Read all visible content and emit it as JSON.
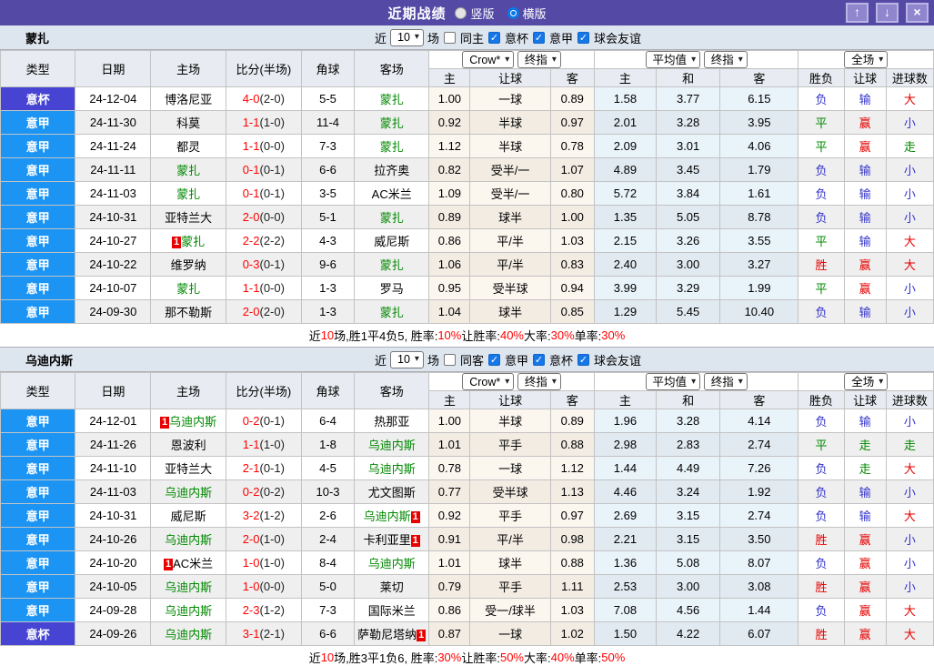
{
  "titlebar": {
    "title": "近期战绩",
    "radios": [
      {
        "label": "竖版",
        "selected": false
      },
      {
        "label": "横版",
        "selected": true
      }
    ],
    "window_buttons": [
      {
        "name": "scroll-up-button",
        "icon": "up-arrow-icon",
        "glyph": "↑"
      },
      {
        "name": "scroll-down-button",
        "icon": "down-arrow-icon",
        "glyph": "↓"
      },
      {
        "name": "close-button",
        "icon": "close-icon",
        "glyph": "×"
      }
    ]
  },
  "table_headers": {
    "left": [
      "类型",
      "日期",
      "主场",
      "比分(半场)",
      "角球",
      "客场"
    ],
    "odds_selects": [
      "Crow*",
      "终指"
    ],
    "odds_cols": [
      "主",
      "让球",
      "客"
    ],
    "avg_selects": [
      "平均值",
      "终指"
    ],
    "avg_cols": [
      "主",
      "和",
      "客"
    ],
    "scope_select": "全场",
    "result_cols": [
      "胜负",
      "让球",
      "进球数"
    ]
  },
  "result_colors": {
    "胜": "#E60000",
    "赢": "#E60000",
    "大": "#E60000",
    "负": "#3333CC",
    "输": "#3333CC",
    "小": "#3333CC",
    "平": "#008800",
    "走": "#008800"
  },
  "colors": {
    "titlebar_bg": "#544AA6",
    "button_bg": "#8F86CE",
    "league_blue": "#1C94F4",
    "cup_purple": "#4744D4",
    "team_green": "#008800",
    "score_red": "#FF0000",
    "filter_bg": "#DDE5EF",
    "header_bg": "#E8EBF1",
    "odds_bg": "#FBF6EE",
    "avg_bg": "#E9F3FA",
    "row_alt": "#EFEFEF"
  },
  "sections": [
    {
      "team": "蒙扎",
      "filter": {
        "near_label": "近",
        "count": "10",
        "games_label": "场",
        "same_label": "同主",
        "same_checked": false,
        "leagues": [
          {
            "label": "意杯",
            "checked": true
          },
          {
            "label": "意甲",
            "checked": true
          },
          {
            "label": "球会友谊",
            "checked": true
          }
        ]
      },
      "rows": [
        {
          "type": "意杯",
          "cup": true,
          "date": "24-12-04",
          "home": "博洛尼亚",
          "home_focus": false,
          "home_badge": false,
          "score": "4-0",
          "half": "(2-0)",
          "corner": "5-5",
          "away": "蒙扎",
          "away_focus": true,
          "away_badge": false,
          "odds_home": "1.00",
          "handicap": "一球",
          "odds_away": "0.89",
          "avg_home": "1.58",
          "avg_draw": "3.77",
          "avg_away": "6.15",
          "res_match": "负",
          "res_handicap": "输",
          "res_goals": "大"
        },
        {
          "type": "意甲",
          "cup": false,
          "date": "24-11-30",
          "home": "科莫",
          "home_focus": false,
          "home_badge": false,
          "score": "1-1",
          "half": "(1-0)",
          "corner": "11-4",
          "away": "蒙扎",
          "away_focus": true,
          "away_badge": false,
          "odds_home": "0.92",
          "handicap": "半球",
          "odds_away": "0.97",
          "avg_home": "2.01",
          "avg_draw": "3.28",
          "avg_away": "3.95",
          "res_match": "平",
          "res_handicap": "赢",
          "res_goals": "小"
        },
        {
          "type": "意甲",
          "cup": false,
          "date": "24-11-24",
          "home": "都灵",
          "home_focus": false,
          "home_badge": false,
          "score": "1-1",
          "half": "(0-0)",
          "corner": "7-3",
          "away": "蒙扎",
          "away_focus": true,
          "away_badge": false,
          "odds_home": "1.12",
          "handicap": "半球",
          "odds_away": "0.78",
          "avg_home": "2.09",
          "avg_draw": "3.01",
          "avg_away": "4.06",
          "res_match": "平",
          "res_handicap": "赢",
          "res_goals": "走"
        },
        {
          "type": "意甲",
          "cup": false,
          "date": "24-11-11",
          "home": "蒙扎",
          "home_focus": true,
          "home_badge": false,
          "score": "0-1",
          "half": "(0-1)",
          "corner": "6-6",
          "away": "拉齐奥",
          "away_focus": false,
          "away_badge": false,
          "odds_home": "0.82",
          "handicap": "受半/一",
          "odds_away": "1.07",
          "avg_home": "4.89",
          "avg_draw": "3.45",
          "avg_away": "1.79",
          "res_match": "负",
          "res_handicap": "输",
          "res_goals": "小"
        },
        {
          "type": "意甲",
          "cup": false,
          "date": "24-11-03",
          "home": "蒙扎",
          "home_focus": true,
          "home_badge": false,
          "score": "0-1",
          "half": "(0-1)",
          "corner": "3-5",
          "away": "AC米兰",
          "away_focus": false,
          "away_badge": false,
          "odds_home": "1.09",
          "handicap": "受半/一",
          "odds_away": "0.80",
          "avg_home": "5.72",
          "avg_draw": "3.84",
          "avg_away": "1.61",
          "res_match": "负",
          "res_handicap": "输",
          "res_goals": "小"
        },
        {
          "type": "意甲",
          "cup": false,
          "date": "24-10-31",
          "home": "亚特兰大",
          "home_focus": false,
          "home_badge": false,
          "score": "2-0",
          "half": "(0-0)",
          "corner": "5-1",
          "away": "蒙扎",
          "away_focus": true,
          "away_badge": false,
          "odds_home": "0.89",
          "handicap": "球半",
          "odds_away": "1.00",
          "avg_home": "1.35",
          "avg_draw": "5.05",
          "avg_away": "8.78",
          "res_match": "负",
          "res_handicap": "输",
          "res_goals": "小"
        },
        {
          "type": "意甲",
          "cup": false,
          "date": "24-10-27",
          "home": "蒙扎",
          "home_focus": true,
          "home_badge": true,
          "score": "2-2",
          "half": "(2-2)",
          "corner": "4-3",
          "away": "威尼斯",
          "away_focus": false,
          "away_badge": false,
          "odds_home": "0.86",
          "handicap": "平/半",
          "odds_away": "1.03",
          "avg_home": "2.15",
          "avg_draw": "3.26",
          "avg_away": "3.55",
          "res_match": "平",
          "res_handicap": "输",
          "res_goals": "大"
        },
        {
          "type": "意甲",
          "cup": false,
          "date": "24-10-22",
          "home": "维罗纳",
          "home_focus": false,
          "home_badge": false,
          "score": "0-3",
          "half": "(0-1)",
          "corner": "9-6",
          "away": "蒙扎",
          "away_focus": true,
          "away_badge": false,
          "odds_home": "1.06",
          "handicap": "平/半",
          "odds_away": "0.83",
          "avg_home": "2.40",
          "avg_draw": "3.00",
          "avg_away": "3.27",
          "res_match": "胜",
          "res_handicap": "赢",
          "res_goals": "大"
        },
        {
          "type": "意甲",
          "cup": false,
          "date": "24-10-07",
          "home": "蒙扎",
          "home_focus": true,
          "home_badge": false,
          "score": "1-1",
          "half": "(0-0)",
          "corner": "1-3",
          "away": "罗马",
          "away_focus": false,
          "away_badge": false,
          "odds_home": "0.95",
          "handicap": "受半球",
          "odds_away": "0.94",
          "avg_home": "3.99",
          "avg_draw": "3.29",
          "avg_away": "1.99",
          "res_match": "平",
          "res_handicap": "赢",
          "res_goals": "小"
        },
        {
          "type": "意甲",
          "cup": false,
          "date": "24-09-30",
          "home": "那不勒斯",
          "home_focus": false,
          "home_badge": false,
          "score": "2-0",
          "half": "(2-0)",
          "corner": "1-3",
          "away": "蒙扎",
          "away_focus": true,
          "away_badge": false,
          "odds_home": "1.04",
          "handicap": "球半",
          "odds_away": "0.85",
          "avg_home": "1.29",
          "avg_draw": "5.45",
          "avg_away": "10.40",
          "res_match": "负",
          "res_handicap": "输",
          "res_goals": "小"
        }
      ],
      "summary": [
        {
          "t": "近",
          "red": false
        },
        {
          "t": "10",
          "red": true
        },
        {
          "t": "场,胜1平4负5, 胜率:",
          "red": false
        },
        {
          "t": "10%",
          "red": true
        },
        {
          "t": " 让胜率:",
          "red": false
        },
        {
          "t": "40%",
          "red": true
        },
        {
          "t": " 大率:",
          "red": false
        },
        {
          "t": "30%",
          "red": true
        },
        {
          "t": " 单率:",
          "red": false
        },
        {
          "t": "30%",
          "red": true
        }
      ]
    },
    {
      "team": "乌迪内斯",
      "filter": {
        "near_label": "近",
        "count": "10",
        "games_label": "场",
        "same_label": "同客",
        "same_checked": false,
        "leagues": [
          {
            "label": "意甲",
            "checked": true
          },
          {
            "label": "意杯",
            "checked": true
          },
          {
            "label": "球会友谊",
            "checked": true
          }
        ]
      },
      "rows": [
        {
          "type": "意甲",
          "cup": false,
          "date": "24-12-01",
          "home": "乌迪内斯",
          "home_focus": true,
          "home_badge": true,
          "score": "0-2",
          "half": "(0-1)",
          "corner": "6-4",
          "away": "热那亚",
          "away_focus": false,
          "away_badge": false,
          "odds_home": "1.00",
          "handicap": "半球",
          "odds_away": "0.89",
          "avg_home": "1.96",
          "avg_draw": "3.28",
          "avg_away": "4.14",
          "res_match": "负",
          "res_handicap": "输",
          "res_goals": "小"
        },
        {
          "type": "意甲",
          "cup": false,
          "date": "24-11-26",
          "home": "恩波利",
          "home_focus": false,
          "home_badge": false,
          "score": "1-1",
          "half": "(1-0)",
          "corner": "1-8",
          "away": "乌迪内斯",
          "away_focus": true,
          "away_badge": false,
          "odds_home": "1.01",
          "handicap": "平手",
          "odds_away": "0.88",
          "avg_home": "2.98",
          "avg_draw": "2.83",
          "avg_away": "2.74",
          "res_match": "平",
          "res_handicap": "走",
          "res_goals": "走"
        },
        {
          "type": "意甲",
          "cup": false,
          "date": "24-11-10",
          "home": "亚特兰大",
          "home_focus": false,
          "home_badge": false,
          "score": "2-1",
          "half": "(0-1)",
          "corner": "4-5",
          "away": "乌迪内斯",
          "away_focus": true,
          "away_badge": false,
          "odds_home": "0.78",
          "handicap": "一球",
          "odds_away": "1.12",
          "avg_home": "1.44",
          "avg_draw": "4.49",
          "avg_away": "7.26",
          "res_match": "负",
          "res_handicap": "走",
          "res_goals": "大"
        },
        {
          "type": "意甲",
          "cup": false,
          "date": "24-11-03",
          "home": "乌迪内斯",
          "home_focus": true,
          "home_badge": false,
          "score": "0-2",
          "half": "(0-2)",
          "corner": "10-3",
          "away": "尤文图斯",
          "away_focus": false,
          "away_badge": false,
          "odds_home": "0.77",
          "handicap": "受半球",
          "odds_away": "1.13",
          "avg_home": "4.46",
          "avg_draw": "3.24",
          "avg_away": "1.92",
          "res_match": "负",
          "res_handicap": "输",
          "res_goals": "小"
        },
        {
          "type": "意甲",
          "cup": false,
          "date": "24-10-31",
          "home": "威尼斯",
          "home_focus": false,
          "home_badge": false,
          "score": "3-2",
          "half": "(1-2)",
          "corner": "2-6",
          "away": "乌迪内斯",
          "away_focus": true,
          "away_badge": true,
          "odds_home": "0.92",
          "handicap": "平手",
          "odds_away": "0.97",
          "avg_home": "2.69",
          "avg_draw": "3.15",
          "avg_away": "2.74",
          "res_match": "负",
          "res_handicap": "输",
          "res_goals": "大"
        },
        {
          "type": "意甲",
          "cup": false,
          "date": "24-10-26",
          "home": "乌迪内斯",
          "home_focus": true,
          "home_badge": false,
          "score": "2-0",
          "half": "(1-0)",
          "corner": "2-4",
          "away": "卡利亚里",
          "away_focus": false,
          "away_badge": true,
          "odds_home": "0.91",
          "handicap": "平/半",
          "odds_away": "0.98",
          "avg_home": "2.21",
          "avg_draw": "3.15",
          "avg_away": "3.50",
          "res_match": "胜",
          "res_handicap": "赢",
          "res_goals": "小"
        },
        {
          "type": "意甲",
          "cup": false,
          "date": "24-10-20",
          "home": "AC米兰",
          "home_focus": false,
          "home_badge": true,
          "score": "1-0",
          "half": "(1-0)",
          "corner": "8-4",
          "away": "乌迪内斯",
          "away_focus": true,
          "away_badge": false,
          "odds_home": "1.01",
          "handicap": "球半",
          "odds_away": "0.88",
          "avg_home": "1.36",
          "avg_draw": "5.08",
          "avg_away": "8.07",
          "res_match": "负",
          "res_handicap": "赢",
          "res_goals": "小"
        },
        {
          "type": "意甲",
          "cup": false,
          "date": "24-10-05",
          "home": "乌迪内斯",
          "home_focus": true,
          "home_badge": false,
          "score": "1-0",
          "half": "(0-0)",
          "corner": "5-0",
          "away": "莱切",
          "away_focus": false,
          "away_badge": false,
          "odds_home": "0.79",
          "handicap": "平手",
          "odds_away": "1.11",
          "avg_home": "2.53",
          "avg_draw": "3.00",
          "avg_away": "3.08",
          "res_match": "胜",
          "res_handicap": "赢",
          "res_goals": "小"
        },
        {
          "type": "意甲",
          "cup": false,
          "date": "24-09-28",
          "home": "乌迪内斯",
          "home_focus": true,
          "home_badge": false,
          "score": "2-3",
          "half": "(1-2)",
          "corner": "7-3",
          "away": "国际米兰",
          "away_focus": false,
          "away_badge": false,
          "odds_home": "0.86",
          "handicap": "受一/球半",
          "odds_away": "1.03",
          "avg_home": "7.08",
          "avg_draw": "4.56",
          "avg_away": "1.44",
          "res_match": "负",
          "res_handicap": "赢",
          "res_goals": "大"
        },
        {
          "type": "意杯",
          "cup": true,
          "date": "24-09-26",
          "home": "乌迪内斯",
          "home_focus": true,
          "home_badge": false,
          "score": "3-1",
          "half": "(2-1)",
          "corner": "6-6",
          "away": "萨勒尼塔纳",
          "away_focus": false,
          "away_badge": true,
          "odds_home": "0.87",
          "handicap": "一球",
          "odds_away": "1.02",
          "avg_home": "1.50",
          "avg_draw": "4.22",
          "avg_away": "6.07",
          "res_match": "胜",
          "res_handicap": "赢",
          "res_goals": "大"
        }
      ],
      "summary": [
        {
          "t": "近",
          "red": false
        },
        {
          "t": "10",
          "red": true
        },
        {
          "t": "场,胜3平1负6, 胜率:",
          "red": false
        },
        {
          "t": "30%",
          "red": true
        },
        {
          "t": " 让胜率:",
          "red": false
        },
        {
          "t": "50%",
          "red": true
        },
        {
          "t": " 大率:",
          "red": false
        },
        {
          "t": "40%",
          "red": true
        },
        {
          "t": " 单率:",
          "red": false
        },
        {
          "t": "50%",
          "red": true
        }
      ]
    }
  ]
}
